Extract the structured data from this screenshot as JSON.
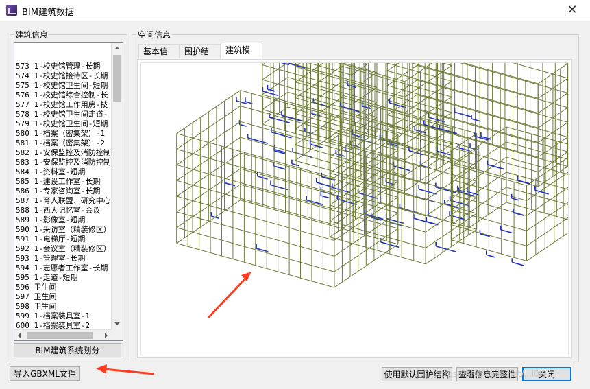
{
  "window": {
    "title": "BIM建筑数据"
  },
  "building_info": {
    "label": "建筑信息",
    "items": [
      "573 1-校史馆管理-长期",
      "574 1-校史馆接待区-长期",
      "575 1-校史馆卫生间-短期",
      "576 1-校史馆综合控制-长",
      "577 1-校史馆工作用房-技",
      "578 1-校史馆卫生间走道-",
      "579 1-校史馆卫生间-短期",
      "580 1-档案（密集架）-1",
      "581 1-档案（密集架）-2",
      "582 1-安保监控及消防控制",
      "583 1-安保监控及消防控制",
      "584 1-资料室-短期",
      "585 1-建设工作室-长期",
      "586 1-专家咨询室-长期",
      "587 1-育人联盟、研究中心",
      "588 1-西大记忆室-会议",
      "589 1-影像室-短期",
      "590 1-采访室（精装修区）",
      "591 1-电梯厅-短期",
      "592 1-会议室（精装修区）",
      "593 1-管理室-长期",
      "594 1-志愿者工作室-长期",
      "595 1-走道-短期",
      "596 卫生间",
      "597 卫生间",
      "598 卫生间",
      "599 1-档案装具室-1",
      "600 1-档案装具室-2"
    ],
    "system_button": "BIM建筑系统划分"
  },
  "space_info": {
    "label": "空间信息",
    "tabs": [
      "基本信息",
      "围护结构",
      "建筑模型"
    ],
    "active_tab": "建筑模型"
  },
  "buttons": {
    "import": "导入GBXML文件",
    "use_default": "使用默认围护结构",
    "check": "查看信息完整性",
    "close": "关闭"
  },
  "watermark": "https://blog.csdn.net/...l0l9",
  "colors": {
    "model_edges": "#6b7a35",
    "model_openings": "#1f2fbf",
    "annotation_arrow": "#ff3b1f"
  },
  "icons": {
    "app": "app-icon",
    "close": "close-icon"
  }
}
